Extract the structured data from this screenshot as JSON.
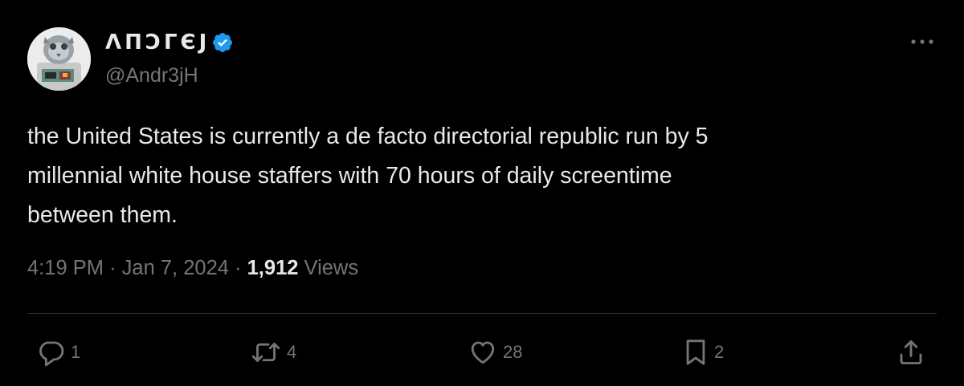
{
  "author": {
    "display_name": "ΛПↃΓЄJ",
    "handle": "@Andr3jH",
    "verified": true
  },
  "tweet": {
    "lines": [
      "the United States is currently a de facto directorial republic run by 5",
      "millennial white house staffers with 70 hours of daily screentime",
      "between them."
    ]
  },
  "meta": {
    "time": "4:19 PM",
    "separator1": "·",
    "date": "Jan 7, 2024",
    "separator2": "·",
    "views_count": "1,912",
    "views_label": "Views"
  },
  "actions": {
    "reply_count": "1",
    "repost_count": "4",
    "like_count": "28",
    "bookmark_count": "2"
  },
  "colors": {
    "background": "#000000",
    "text": "#e7e9ea",
    "muted": "#71767b",
    "verified": "#1d9bf0",
    "divider": "#2f3336"
  },
  "icons": [
    "avatar-image",
    "verified-badge-icon",
    "more-icon",
    "reply-icon",
    "repost-icon",
    "like-icon",
    "bookmark-icon",
    "share-icon"
  ]
}
